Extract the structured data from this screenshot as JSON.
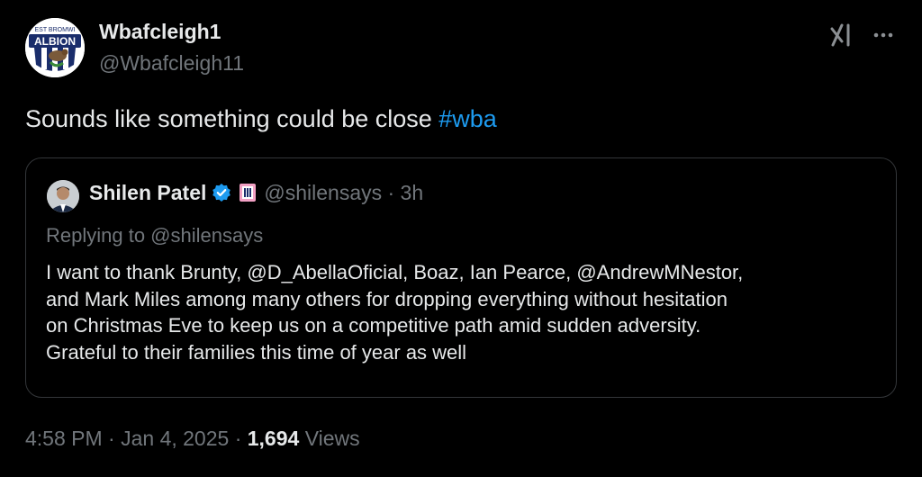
{
  "author": {
    "display_name": "Wbafcleigh1",
    "handle": "@Wbafcleigh11",
    "avatar_icon": "west-bromwich-albion-crest",
    "avatar_text_top": "EST BROMWI",
    "avatar_text_main": "ALBION"
  },
  "tweet": {
    "text": "Sounds like something could be close ",
    "hashtag": "#wba"
  },
  "quoted": {
    "name": "Shilen Patel",
    "handle_time": "@shilensays · 3h",
    "verified_icon": "verified-badge-icon",
    "affiliate_icon": "affiliate-badge-icon",
    "replying_to": "Replying to @shilensays",
    "body_lines": [
      "I want to thank Brunty, @D_AbellaOficial, Boaz, Ian Pearce, @AndrewMNestor,",
      "and Mark Miles among many others for dropping everything without hesitation",
      "on Christmas Eve to keep us on a competitive path amid sudden adversity.",
      "Grateful to their families this time of year as well"
    ]
  },
  "meta": {
    "time_date": "4:58 PM · Jan 4, 2025 · ",
    "views_count": "1,694",
    "views_label": " Views"
  },
  "colors": {
    "background": "#000000",
    "text": "#e7e9ea",
    "muted": "#71767b",
    "link": "#1d9bf0",
    "border": "#333639"
  }
}
